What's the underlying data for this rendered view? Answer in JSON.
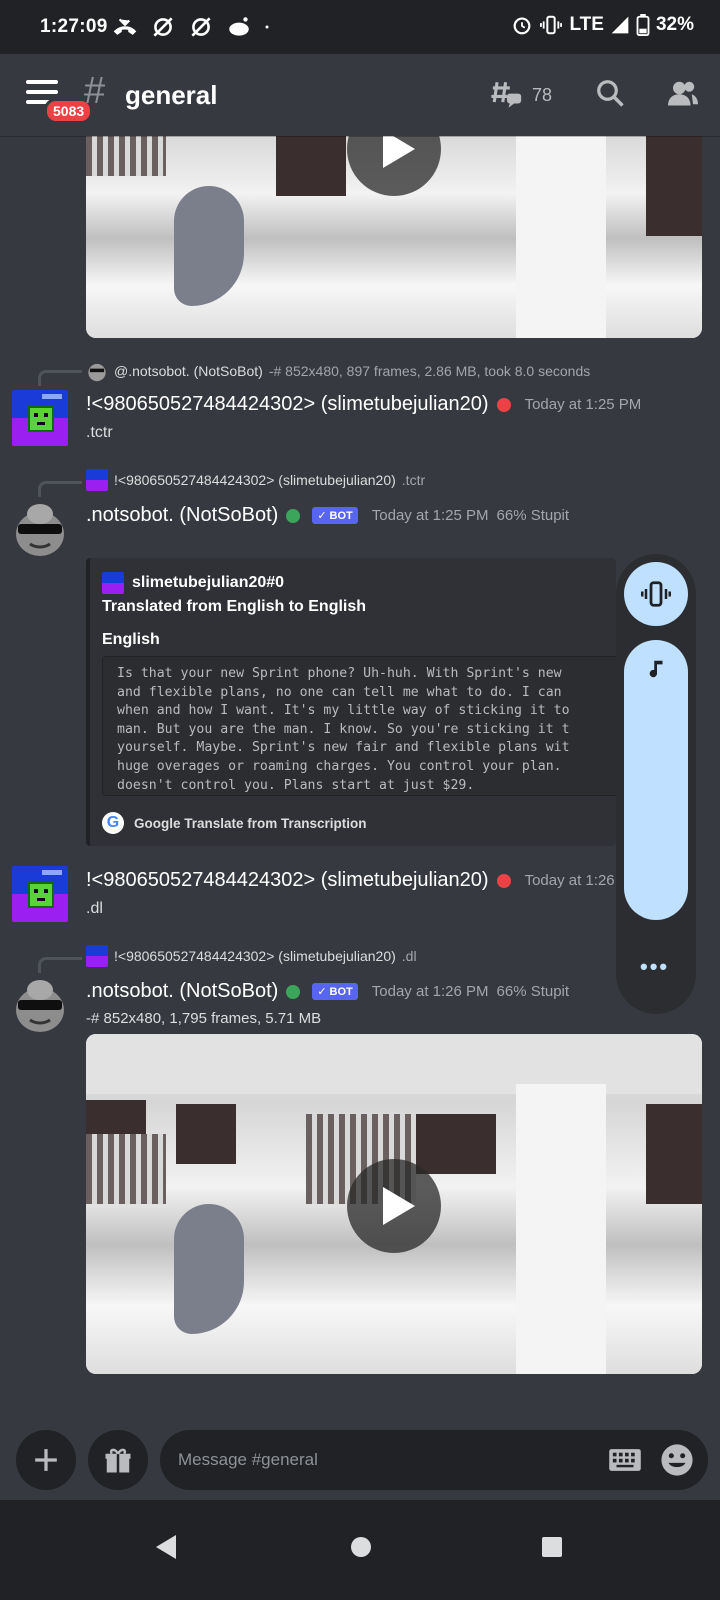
{
  "status_bar": {
    "time": "1:27:09",
    "network": "LTE",
    "battery": "32%"
  },
  "header": {
    "unread_badge": "5083",
    "channel": "general",
    "threads_count": "78"
  },
  "messages": {
    "reply1": {
      "author": "@.notsobot. (NotSoBot)",
      "text": "-# 852x480, 897 frames, 2.86 MB, took 8.0 seconds"
    },
    "msg1": {
      "author": "!<980650527484424302> (slimetubejulian20)",
      "timestamp": "Today at 1:25 PM",
      "text": ".tctr"
    },
    "reply2": {
      "author": "!<980650527484424302> (slimetubejulian20)",
      "text": ".tctr"
    },
    "msg2": {
      "author": ".notsobot. (NotSoBot)",
      "bot_tag": "BOT",
      "timestamp": "Today at 1:25 PM",
      "extra": "66% Stupit"
    },
    "embed": {
      "author": "slimetubejulian20#0",
      "title": "Translated from English to English",
      "field_name": "English",
      "code": "Is that your new Sprint phone? Uh-huh. With Sprint's new\nand flexible plans, no one can tell me what to do. I can\nwhen and how I want. It's my little way of sticking it to\nman. But you are the man. I know. So you're sticking it t\nyourself. Maybe. Sprint's new fair and flexible plans wit\nhuge overages or roaming charges. You control your plan.\ndoesn't control you. Plans start at just $29.",
      "footer": "Google Translate from Transcription"
    },
    "msg3": {
      "author": "!<980650527484424302> (slimetubejulian20)",
      "timestamp": "Today at 1:26 PM",
      "text": ".dl"
    },
    "reply3": {
      "author": "!<980650527484424302> (slimetubejulian20)",
      "text": ".dl"
    },
    "msg4": {
      "author": ".notsobot. (NotSoBot)",
      "bot_tag": "BOT",
      "timestamp": "Today at 1:26 PM",
      "extra": "66% Stupit",
      "text": "-# 852x480, 1,795 frames, 5.71 MB"
    }
  },
  "input": {
    "placeholder": "Message #general"
  }
}
